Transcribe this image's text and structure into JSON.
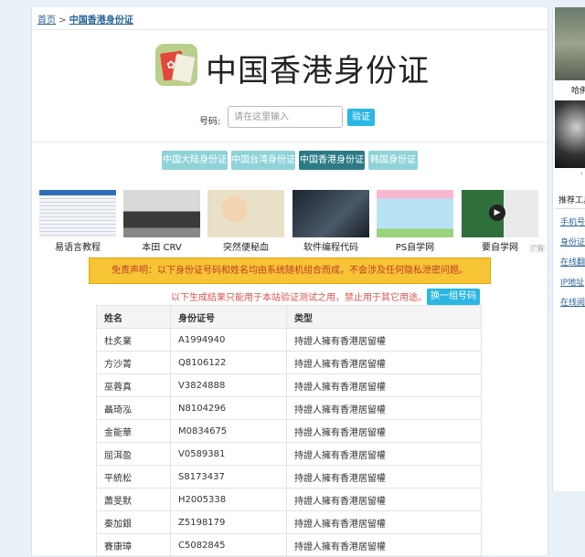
{
  "breadcrumb": {
    "home": "首页",
    "sep": " > ",
    "current": "中国香港身份证"
  },
  "header": {
    "title": "中国香港身份证",
    "icon": "hk-id-card-app-icon"
  },
  "form": {
    "label": "号码:",
    "placeholder": "请在这里输入",
    "verify_label": "验证"
  },
  "region_tabs": [
    {
      "label": "中国大陆身份证",
      "active": false
    },
    {
      "label": "中国台湾身份证",
      "active": false
    },
    {
      "label": "中国香港身份证",
      "active": true
    },
    {
      "label": "韩国身份证",
      "active": false
    }
  ],
  "thumbnails": [
    {
      "caption": "易语言教程"
    },
    {
      "caption": "本田 CRV"
    },
    {
      "caption": "突然便秘血"
    },
    {
      "caption": "软件编程代码"
    },
    {
      "caption": "PS自学网"
    },
    {
      "caption": "要自学网"
    }
  ],
  "ad_mark": "广告",
  "disclaimer": "免责声明：以下身份证号码和姓名均由系统随机组合而成，不会涉及任何隐私泄密问题。",
  "note": "以下生成结果只能用于本站验证测试之用，禁止用于其它用途。",
  "regen_label": "换一组号码",
  "table": {
    "headers": [
      "姓名",
      "身份证号",
      "类型"
    ],
    "rows": [
      [
        "杜炙業",
        "A1994940",
        "持證人擁有香港居留權"
      ],
      [
        "方沙菁",
        "Q8106122",
        "持證人擁有香港居留權"
      ],
      [
        "巫蓉真",
        "V3824888",
        "持證人擁有香港居留權"
      ],
      [
        "聶琦泓",
        "N8104296",
        "持證人擁有香港居留權"
      ],
      [
        "金能華",
        "M0834675",
        "持證人擁有香港居留權"
      ],
      [
        "屈洱盈",
        "V0589381",
        "持證人擁有香港居留權"
      ],
      [
        "平統松",
        "S8173437",
        "持證人擁有香港居留權"
      ],
      [
        "蕭旻默",
        "H2005338",
        "持證人擁有香港居留權"
      ],
      [
        "秦加銀",
        "Z5198179",
        "持證人擁有香港居留權"
      ],
      [
        "賽康璋",
        "C5082845",
        "持證人擁有香港居留權"
      ]
    ]
  },
  "sidebar": {
    "caption1": "哈佛",
    "caption2": "·",
    "heading": "推荐工具",
    "links": [
      "手机号",
      "身份证",
      "在线翻",
      "IP地址",
      "在线阅"
    ]
  },
  "colors": {
    "accent": "#2bb7e4",
    "tab": "#8fd3d9",
    "tab_active": "#2b7a85",
    "warning_bg": "#f6c434",
    "warning_text": "#c0392b",
    "link": "#2a6496"
  }
}
